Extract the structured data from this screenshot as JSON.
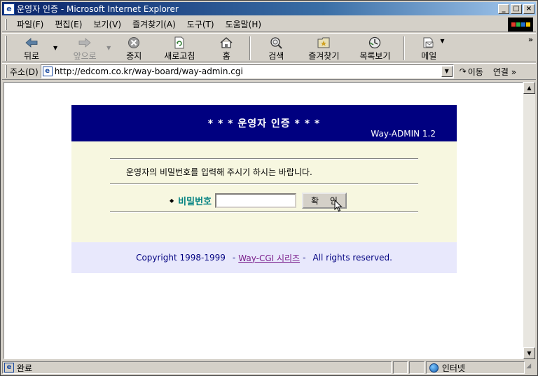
{
  "window": {
    "title": "운영자 인증 - Microsoft Internet Explorer",
    "app_icon": "e"
  },
  "title_buttons": {
    "minimize": "_",
    "maximize": "□",
    "close": "×"
  },
  "menu": [
    "파일(F)",
    "편집(E)",
    "보기(V)",
    "즐겨찾기(A)",
    "도구(T)",
    "도움말(H)"
  ],
  "toolbar": {
    "back": {
      "label": "뒤로",
      "icon": "back-arrow-icon"
    },
    "forward": {
      "label": "앞으로",
      "icon": "forward-arrow-icon",
      "disabled": true
    },
    "stop": {
      "label": "중지",
      "icon": "stop-icon"
    },
    "refresh": {
      "label": "새로고침",
      "icon": "refresh-icon"
    },
    "home": {
      "label": "홈",
      "icon": "home-icon"
    },
    "search": {
      "label": "검색",
      "icon": "search-icon"
    },
    "favorites": {
      "label": "즐겨찾기",
      "icon": "favorites-icon"
    },
    "history": {
      "label": "목록보기",
      "icon": "history-icon"
    },
    "mail": {
      "label": "메일",
      "icon": "mail-icon"
    },
    "more": "»"
  },
  "address": {
    "label": "주소(D)",
    "url": "http://edcom.co.kr/way-board/way-admin.cgi",
    "go_label": "이동",
    "links_label": "연결 »"
  },
  "page": {
    "title": "* * *    운영자 인증    * * *",
    "version": "Way-ADMIN 1.2",
    "instruction": "운영자의 비밀번호를 입력해 주시기 하시는 바랍니다.",
    "password_label": "비밀번호",
    "password_value": "",
    "ok_button": "확 인",
    "footer_copyright": "Copyright 1998-1999",
    "footer_dash1": "-",
    "footer_link": "Way-CGI 시리즈",
    "footer_dash2": "-",
    "footer_rights": "All rights reserved."
  },
  "status": {
    "text": "완료",
    "zone": "인터넷"
  },
  "colors": {
    "header_bg": "#000080",
    "body_bg": "#f7f7e0",
    "footer_bg": "#e8e8fc",
    "label_teal": "#008080",
    "link_purple": "#7a1e8c"
  }
}
